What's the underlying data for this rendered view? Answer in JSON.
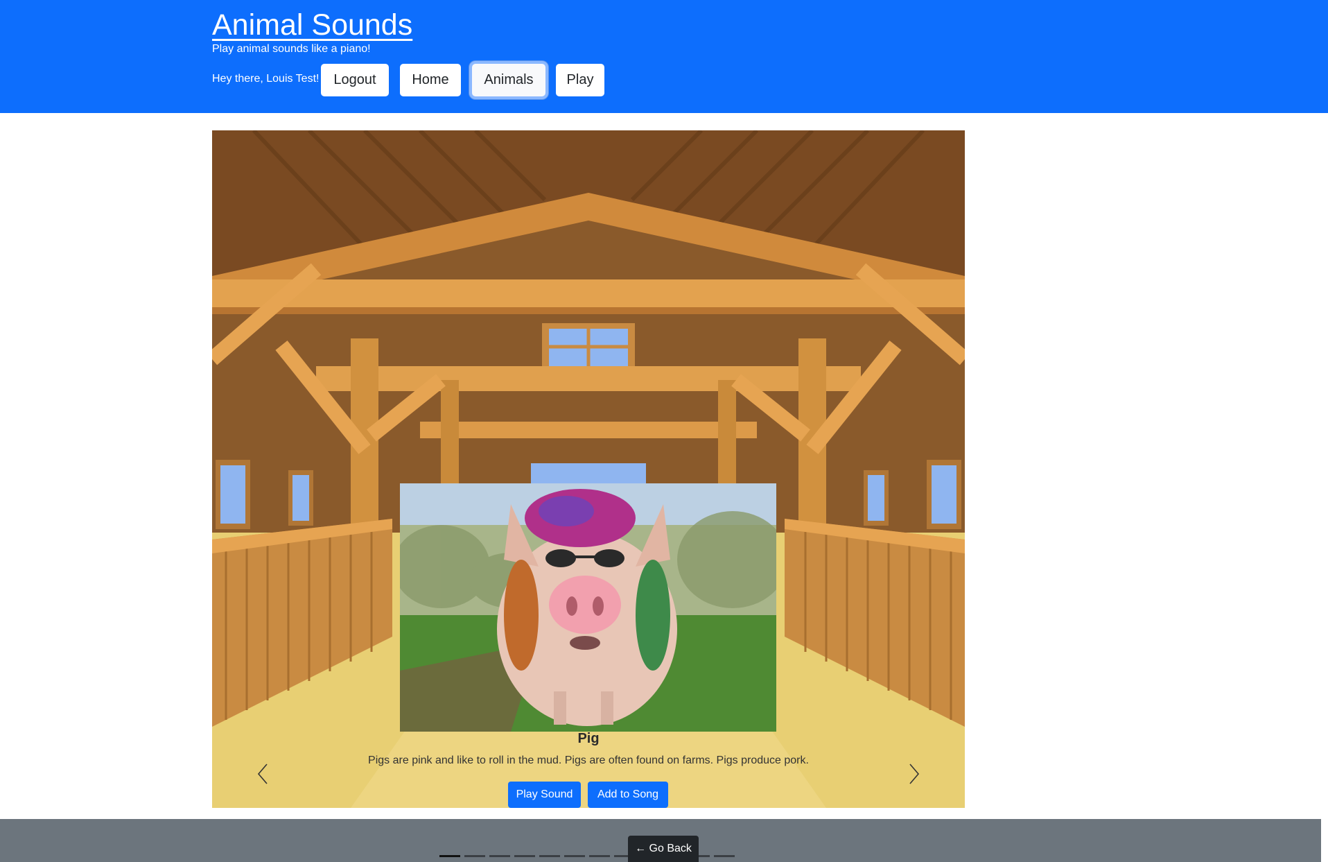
{
  "header": {
    "title": "Animal Sounds",
    "tagline": "Play animal sounds like a piano!",
    "greeting": "Hey there, Louis Test!",
    "nav": {
      "logout": "Logout",
      "home": "Home",
      "animals": "Animals",
      "play": "Play"
    },
    "active_nav": "Animals",
    "accent_color": "#0d6efd"
  },
  "carousel": {
    "animal_name": "Pig",
    "animal_description": "Pigs are pink and like to roll in the mud. Pigs are often found on farms. Pigs produce pork.",
    "play_sound_label": "Play Sound",
    "add_to_song_label": "Add to Song",
    "prev_icon": "chevron-left-icon",
    "next_icon": "chevron-right-icon",
    "slide_count": 12,
    "active_slide": 1
  },
  "footer": {
    "go_back_label": "← Go Back",
    "background_color": "#6c757d"
  }
}
